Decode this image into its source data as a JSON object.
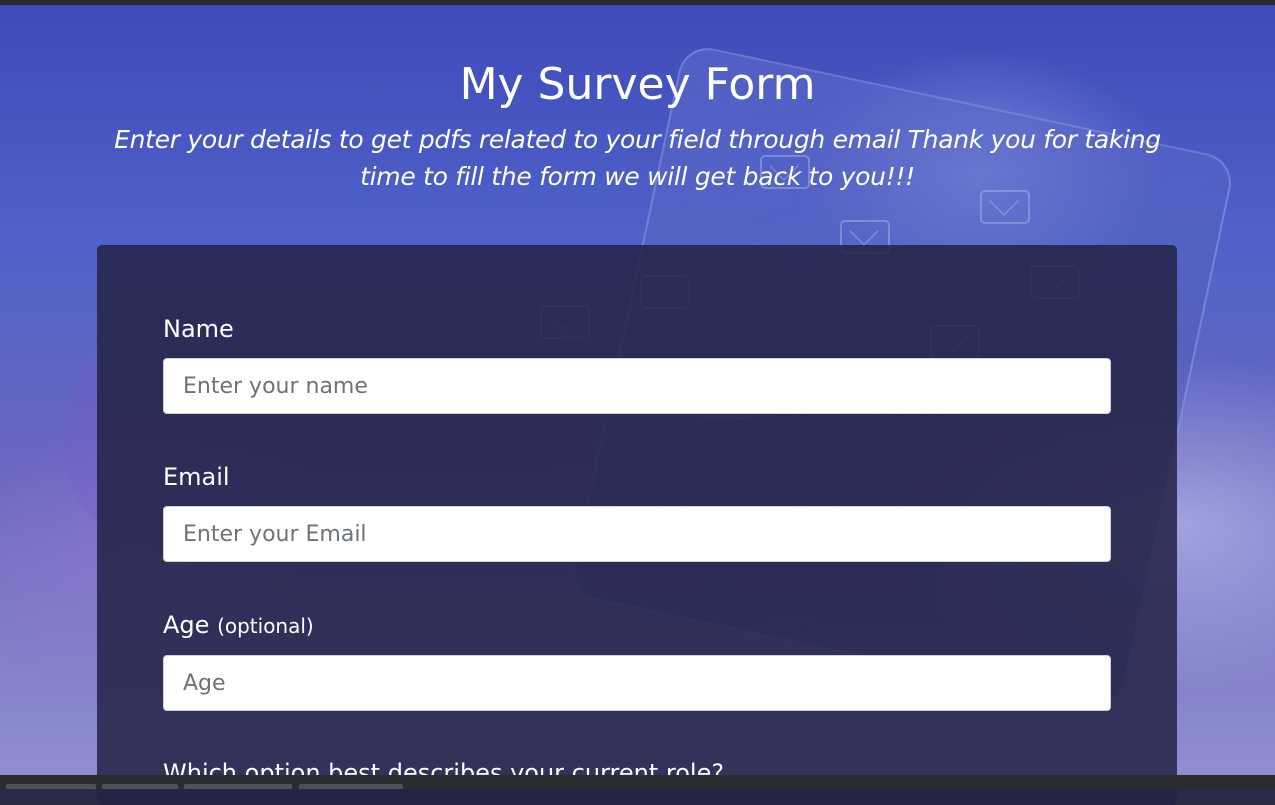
{
  "page": {
    "title": "My Survey Form",
    "description": "Enter your details to get pdfs related to your field through email Thank you for taking time to fill the form we will get back to you!!!"
  },
  "form": {
    "name": {
      "label": "Name",
      "placeholder": "Enter your name",
      "value": ""
    },
    "email": {
      "label": "Email",
      "placeholder": "Enter your Email",
      "value": ""
    },
    "age": {
      "label": "Age",
      "optional_note": "(optional)",
      "placeholder": "Age",
      "value": ""
    },
    "role_question": {
      "label": "Which option best describes your current role?"
    }
  },
  "colors": {
    "card_background": "#232346",
    "text": "#ffffff",
    "input_background": "#ffffff",
    "placeholder": "#6e7378"
  }
}
